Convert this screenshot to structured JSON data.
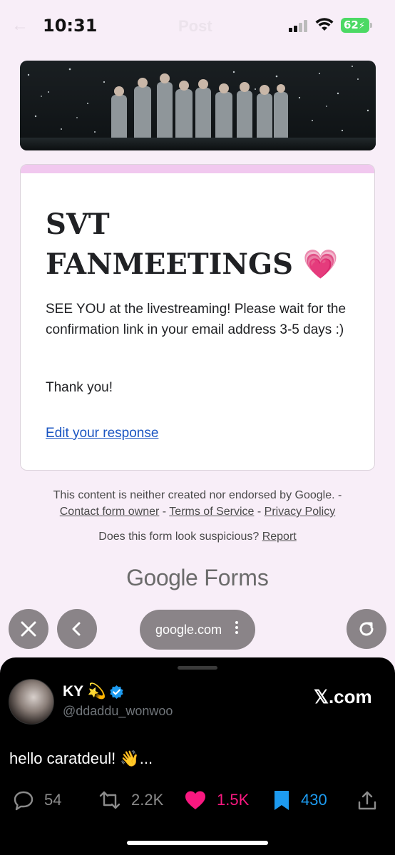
{
  "status_bar": {
    "time": "10:31",
    "battery": "62",
    "ghost_title": "Post",
    "ghost_back": "←"
  },
  "banner": {
    "icon": "concert-photo"
  },
  "form_card": {
    "title": "SVT FANMEETINGS 💗",
    "message": "SEE YOU at the livestreaming! Please wait for the confirmation link in your email address 3-5 days :)",
    "thanks": "Thank you!",
    "edit_link": "Edit your response",
    "accent_color": "#f1c8ef"
  },
  "footer": {
    "disclaimer": "This content is neither created nor endorsed by Google. -",
    "contact_link": "Contact form owner",
    "sep1": " - ",
    "terms_link": "Terms of Service",
    "sep2": " - ",
    "privacy_link": "Privacy Policy",
    "suspicious": "Does this form look suspicious?",
    "report_link": "Report",
    "brand_google": "Google",
    "brand_forms": "Forms"
  },
  "browser": {
    "url": "google.com",
    "close_icon": "close-icon",
    "back_icon": "chevron-left-icon",
    "reload_icon": "reload-icon"
  },
  "tweet": {
    "name": "KY 💫",
    "handle": "@ddaddu_wonwoo",
    "site": "𝕏.com",
    "text": "hello caratdeul! 👋...",
    "replies": "54",
    "reposts": "2.2K",
    "likes": "1.5K",
    "bookmarks": "430",
    "like_color": "#f91880",
    "bookmark_color": "#1d9bf0"
  }
}
